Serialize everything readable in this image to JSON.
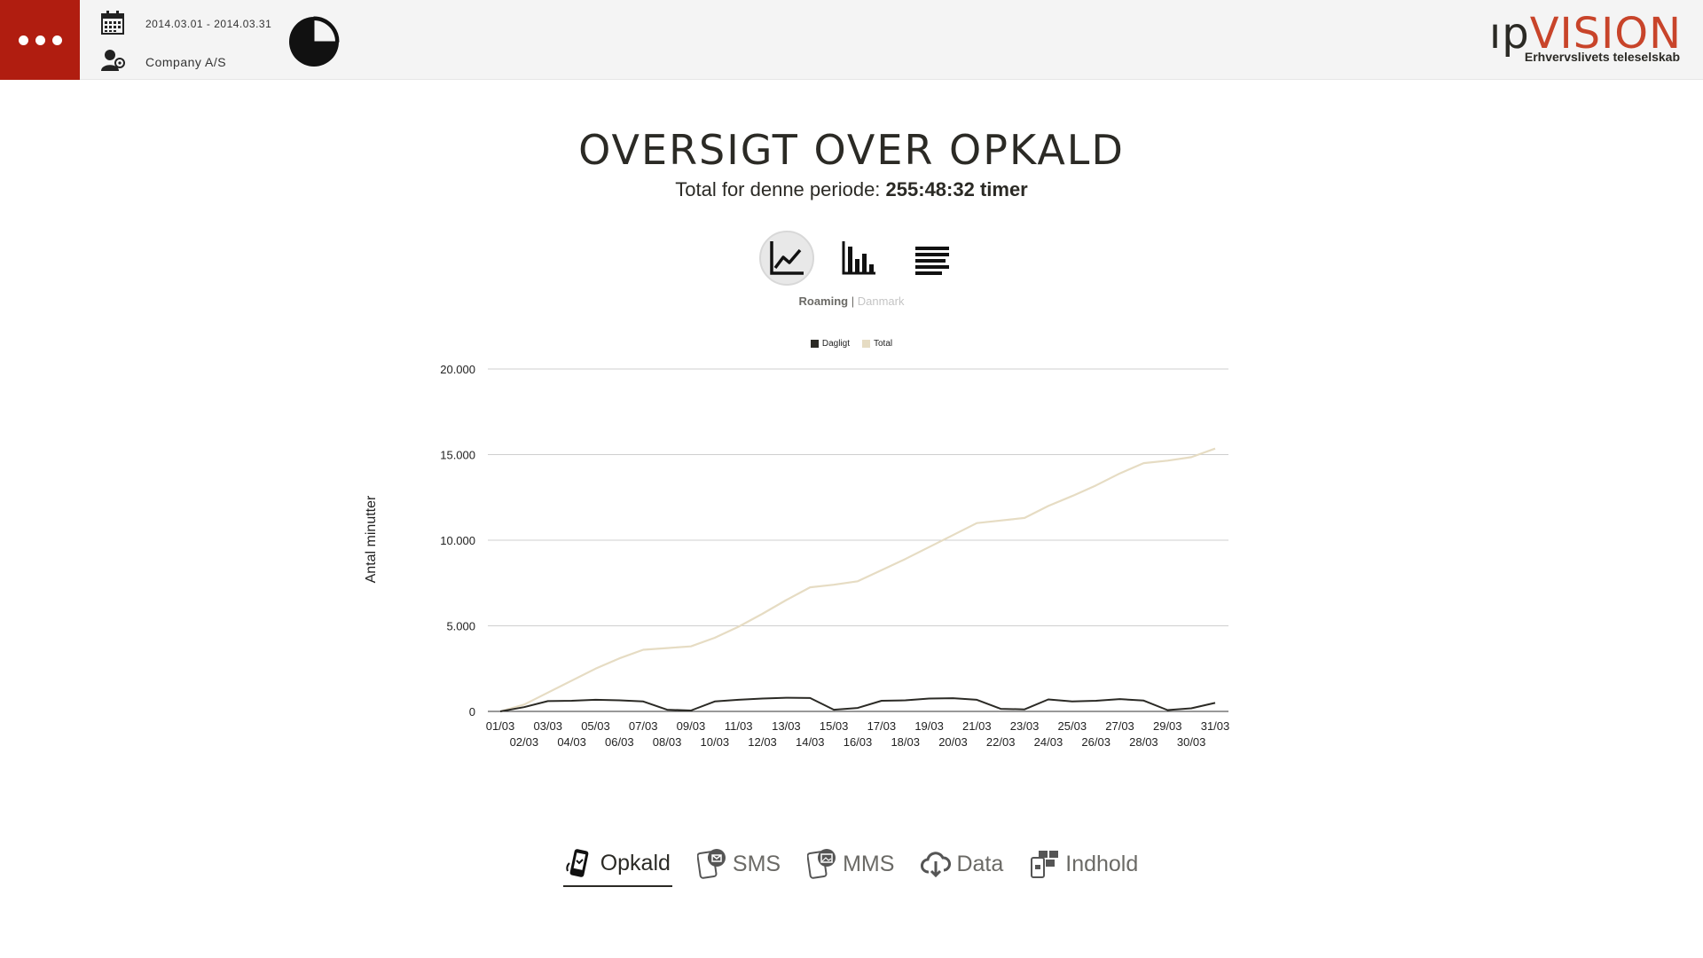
{
  "header": {
    "period": "2014.03.01 - 2014.03.31",
    "company": "Company A/S",
    "logo_ip": "ıp",
    "logo_vision": "VISION",
    "logo_tagline": "Erhvervslivets teleselskab",
    "colors": {
      "menu_bg": "#b01d10",
      "logo_accent": "#c8442a"
    }
  },
  "main": {
    "title": "OVERSIGT OVER OPKALD",
    "subtitle_prefix": "Total for denne periode: ",
    "subtitle_value": "255:48:32 timer",
    "view_buttons": [
      {
        "icon": "line-chart-icon",
        "active": true
      },
      {
        "icon": "bar-chart-icon",
        "active": false
      },
      {
        "icon": "list-icon",
        "active": false
      }
    ],
    "region": {
      "active": "Roaming",
      "separator": "|",
      "inactive": "Danmark"
    }
  },
  "chart_data": {
    "type": "line",
    "title": "",
    "ylabel": "Antal minutter",
    "xlabel": "",
    "ylim": [
      0,
      20000
    ],
    "yticks": [
      "0",
      "5.000",
      "10.000",
      "15.000",
      "20.000"
    ],
    "ytick_values": [
      0,
      5000,
      10000,
      15000,
      20000
    ],
    "legend_position": "top-center",
    "grid": true,
    "x": [
      "01/03",
      "02/03",
      "03/03",
      "04/03",
      "05/03",
      "06/03",
      "07/03",
      "08/03",
      "09/03",
      "10/03",
      "11/03",
      "12/03",
      "13/03",
      "14/03",
      "15/03",
      "16/03",
      "17/03",
      "18/03",
      "19/03",
      "20/03",
      "21/03",
      "22/03",
      "23/03",
      "24/03",
      "25/03",
      "26/03",
      "27/03",
      "28/03",
      "29/03",
      "30/03",
      "31/03"
    ],
    "series": [
      {
        "name": "Dagligt",
        "color": "#2b2a25",
        "values": [
          0,
          250,
          600,
          620,
          680,
          650,
          580,
          100,
          50,
          580,
          680,
          750,
          800,
          780,
          100,
          200,
          620,
          650,
          750,
          770,
          680,
          150,
          120,
          700,
          580,
          620,
          720,
          630,
          80,
          180,
          500
        ]
      },
      {
        "name": "Total",
        "color": "#e6dcc3",
        "values": [
          0,
          400,
          1100,
          1800,
          2500,
          3100,
          3600,
          3700,
          3800,
          4300,
          4950,
          5700,
          6500,
          7250,
          7400,
          7600,
          8250,
          8900,
          9600,
          10300,
          11000,
          11150,
          11300,
          12000,
          12580,
          13200,
          13900,
          14500,
          14650,
          14850,
          15350
        ]
      }
    ]
  },
  "tabs": [
    {
      "label": "Opkald",
      "icon": "phone-call-icon",
      "active": true
    },
    {
      "label": "SMS",
      "icon": "sms-icon",
      "active": false
    },
    {
      "label": "MMS",
      "icon": "mms-icon",
      "active": false
    },
    {
      "label": "Data",
      "icon": "cloud-download-icon",
      "active": false
    },
    {
      "label": "Indhold",
      "icon": "content-icon",
      "active": false
    }
  ]
}
